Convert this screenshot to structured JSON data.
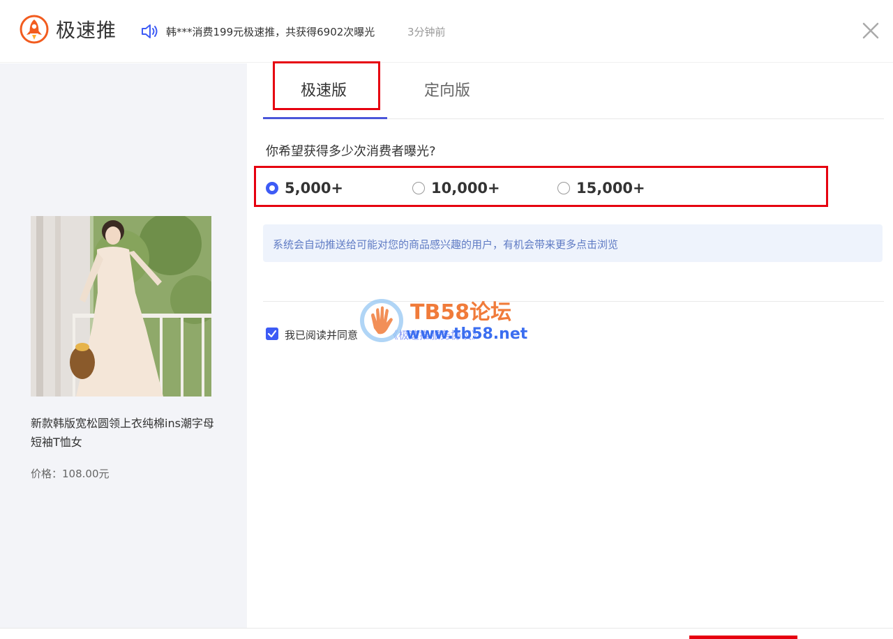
{
  "header": {
    "app_title": "极速推",
    "broadcast": "韩***消费199元极速推，共获得6902次曝光",
    "broadcast_time": "3分钟前",
    "brand_color": "#f25c1f"
  },
  "product": {
    "name": "新款韩版宽松圆领上衣纯棉ins潮字母短袖T恤女",
    "price": "价格：108.00元"
  },
  "tabs": [
    {
      "label": "极速版",
      "active": true
    },
    {
      "label": "定向版",
      "active": false
    }
  ],
  "question": "你希望获得多少次消费者曝光?",
  "options": [
    {
      "label": "5,000+",
      "selected": true
    },
    {
      "label": "10,000+",
      "selected": false
    },
    {
      "label": "15,000+",
      "selected": false
    }
  ],
  "info_text": "系统会自动推送给可能对您的商品感兴趣的用户，有机会带来更多点击浏览",
  "agreement": {
    "checked": true,
    "text": "我已阅读并同意",
    "link": "《极速推服务协议》"
  },
  "watermark": {
    "title": "TB58论坛",
    "url": "www.tb58.net"
  },
  "accent_color": "#3d5bf5",
  "highlight_color": "#e6000f"
}
